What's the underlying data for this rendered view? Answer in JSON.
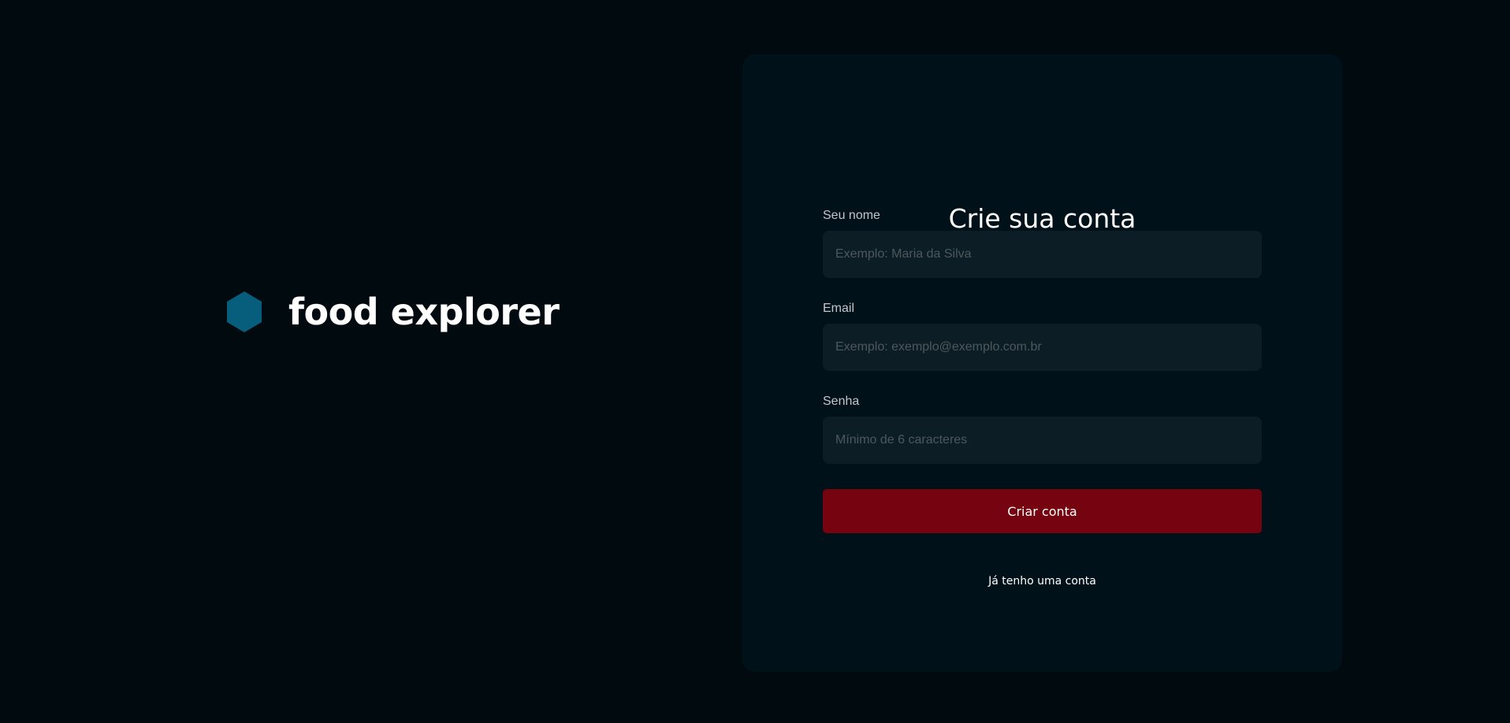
{
  "brand": {
    "name": "food explorer",
    "icon": "hexagon-icon",
    "icon_color": "#065e7c"
  },
  "form": {
    "title": "Crie sua conta",
    "fields": [
      {
        "label": "Seu nome",
        "placeholder": "Exemplo: Maria da Silva",
        "value": ""
      },
      {
        "label": "Email",
        "placeholder": "Exemplo: exemplo@exemplo.com.br",
        "value": ""
      },
      {
        "label": "Senha",
        "placeholder": "Mínimo de 6 caracteres",
        "value": ""
      }
    ],
    "submit_label": "Criar conta",
    "login_link_label": "Já tenho uma conta"
  },
  "colors": {
    "background": "#000a0f",
    "card": "#001119",
    "input": "#0d1d25",
    "accent_button": "#750310",
    "text": "#ffffff"
  }
}
